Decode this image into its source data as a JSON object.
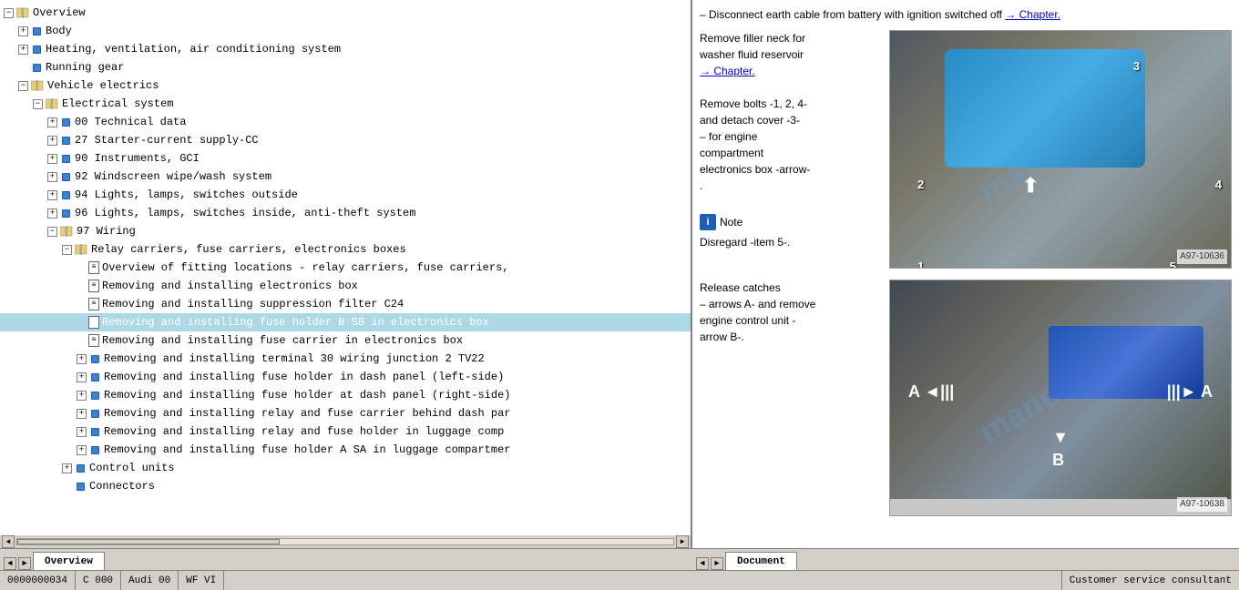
{
  "header": {},
  "left_panel": {
    "tree_items": [
      {
        "id": "overview",
        "label": "Overview",
        "indent": 0,
        "type": "book-open",
        "expanded": true,
        "has_expand": true
      },
      {
        "id": "body",
        "label": "Body",
        "indent": 1,
        "type": "diamond",
        "expanded": false,
        "has_expand": true
      },
      {
        "id": "hvac",
        "label": "Heating, ventilation, air conditioning system",
        "indent": 1,
        "type": "diamond",
        "expanded": false,
        "has_expand": true
      },
      {
        "id": "running-gear",
        "label": "Running gear",
        "indent": 1,
        "type": "diamond",
        "expanded": false,
        "has_expand": false
      },
      {
        "id": "vehicle-electrics",
        "label": "Vehicle electrics",
        "indent": 1,
        "type": "book-open",
        "expanded": true,
        "has_expand": true
      },
      {
        "id": "electrical-system",
        "label": "Electrical system",
        "indent": 2,
        "type": "book-open",
        "expanded": true,
        "has_expand": true
      },
      {
        "id": "00-tech",
        "label": "00  Technical data",
        "indent": 3,
        "type": "diamond",
        "expanded": false,
        "has_expand": true
      },
      {
        "id": "27-starter",
        "label": "27  Starter-current supply-CC",
        "indent": 3,
        "type": "diamond",
        "expanded": false,
        "has_expand": true
      },
      {
        "id": "90-instruments",
        "label": "90  Instruments, GCI",
        "indent": 3,
        "type": "diamond",
        "expanded": false,
        "has_expand": true
      },
      {
        "id": "92-windscreen",
        "label": "92  Windscreen wipe/wash system",
        "indent": 3,
        "type": "diamond",
        "expanded": false,
        "has_expand": true
      },
      {
        "id": "94-lights-out",
        "label": "94  Lights, lamps, switches outside",
        "indent": 3,
        "type": "diamond",
        "expanded": false,
        "has_expand": true
      },
      {
        "id": "96-lights-in",
        "label": "96  Lights, lamps, switches inside, anti-theft system",
        "indent": 3,
        "type": "diamond",
        "expanded": false,
        "has_expand": true
      },
      {
        "id": "97-wiring",
        "label": "97  Wiring",
        "indent": 3,
        "type": "book-open",
        "expanded": true,
        "has_expand": true
      },
      {
        "id": "relay-carriers",
        "label": "Relay carriers, fuse carriers, electronics boxes",
        "indent": 4,
        "type": "book-open",
        "expanded": true,
        "has_expand": true
      },
      {
        "id": "overview-fitting",
        "label": "Overview of fitting locations - relay carriers, fuse carriers,",
        "indent": 5,
        "type": "doc",
        "has_expand": false
      },
      {
        "id": "removing-electronics",
        "label": "Removing and installing electronics box",
        "indent": 5,
        "type": "doc",
        "has_expand": false,
        "selected": false
      },
      {
        "id": "removing-suppression",
        "label": "Removing and installing suppression filter C24",
        "indent": 5,
        "type": "doc",
        "has_expand": false,
        "selected": false
      },
      {
        "id": "removing-fuse-sb",
        "label": "Removing and installing fuse holder B SB in electronics box",
        "indent": 5,
        "type": "doc",
        "has_expand": false,
        "selected": true
      },
      {
        "id": "removing-fuse-carrier",
        "label": "Removing and installing fuse carrier in electronics box",
        "indent": 5,
        "type": "doc",
        "has_expand": false
      },
      {
        "id": "removing-terminal30",
        "label": "Removing and installing terminal 30 wiring junction 2 TV22",
        "indent": 5,
        "type": "diamond",
        "expanded": false,
        "has_expand": true
      },
      {
        "id": "removing-fuse-dash-left",
        "label": "Removing and installing fuse holder in dash panel (left-side)",
        "indent": 5,
        "type": "diamond",
        "expanded": false,
        "has_expand": true
      },
      {
        "id": "removing-fuse-dash-right",
        "label": "Removing and installing fuse holder at dash panel (right-side)",
        "indent": 5,
        "type": "diamond",
        "expanded": false,
        "has_expand": true
      },
      {
        "id": "removing-relay-dash",
        "label": "Removing and installing relay and fuse carrier behind dash par",
        "indent": 5,
        "type": "diamond",
        "expanded": false,
        "has_expand": true
      },
      {
        "id": "removing-relay-luggage",
        "label": "Removing and installing relay and fuse holder in luggage comp",
        "indent": 5,
        "type": "diamond",
        "expanded": false,
        "has_expand": true
      },
      {
        "id": "removing-fuse-sa",
        "label": "Removing and installing fuse holder A SA in luggage compartmer",
        "indent": 5,
        "type": "diamond",
        "expanded": false,
        "has_expand": true
      },
      {
        "id": "control-units",
        "label": "Control units",
        "indent": 4,
        "type": "diamond",
        "expanded": false,
        "has_expand": true
      },
      {
        "id": "connectors",
        "label": "Connectors",
        "indent": 4,
        "type": "diamond",
        "expanded": false,
        "has_expand": false
      }
    ],
    "tab": "Overview"
  },
  "right_panel": {
    "content": {
      "intro_text": "– Disconnect earth cable from battery with ignition switched off",
      "chapter_link": "→ Chapter.",
      "section1": {
        "text_lines": [
          "Remove filler neck for",
          "washer fluid reservoir",
          "→ Chapter.",
          "",
          "Remove bolts -1, 2, 4-",
          "and detach cover -3-",
          "– for engine",
          "compartment",
          "electronics box -arrow-",
          "."
        ],
        "note": "Note",
        "note_text": "Disregard -item 5-.",
        "image_ref": "A97-10636",
        "labels": [
          "1",
          "2",
          "3",
          "4",
          "5"
        ]
      },
      "section2": {
        "text_lines": [
          "Release catches",
          "– arrows A- and remove",
          "engine control unit -",
          "arrow B-."
        ],
        "image_ref": "A97-10638",
        "labels": [
          "A",
          "A",
          "B"
        ]
      }
    },
    "tab": "Document"
  },
  "status_bar": {
    "segment1": "0000000034",
    "segment2": "C 000",
    "segment3": "Audi 00",
    "segment4": "WF  VI",
    "segment5": "Customer service consultant"
  },
  "icons": {
    "expand_plus": "+",
    "expand_minus": "−",
    "arrow_left": "◄",
    "arrow_right": "►",
    "arrow_up": "▲",
    "arrow_down": "▼",
    "nav_left": "◄",
    "nav_right": "►"
  }
}
